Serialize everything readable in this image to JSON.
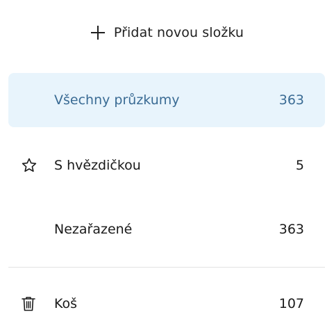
{
  "add_folder": {
    "label": "Přidat novou složku",
    "icon": "plus-icon"
  },
  "folders": [
    {
      "name": "Všechny průzkumy",
      "count": "363",
      "icon": "",
      "active": true
    },
    {
      "name": "S hvězdičkou",
      "count": "5",
      "icon": "star-icon",
      "active": false
    },
    {
      "name": "Nezařazené",
      "count": "363",
      "icon": "",
      "active": false
    }
  ],
  "trash": {
    "name": "Koš",
    "count": "107",
    "icon": "trash-icon"
  },
  "colors": {
    "active_background": "#e8f4fc",
    "active_text": "#3a6b94",
    "text": "#1a1a1a",
    "divider": "#e3e3e3"
  }
}
